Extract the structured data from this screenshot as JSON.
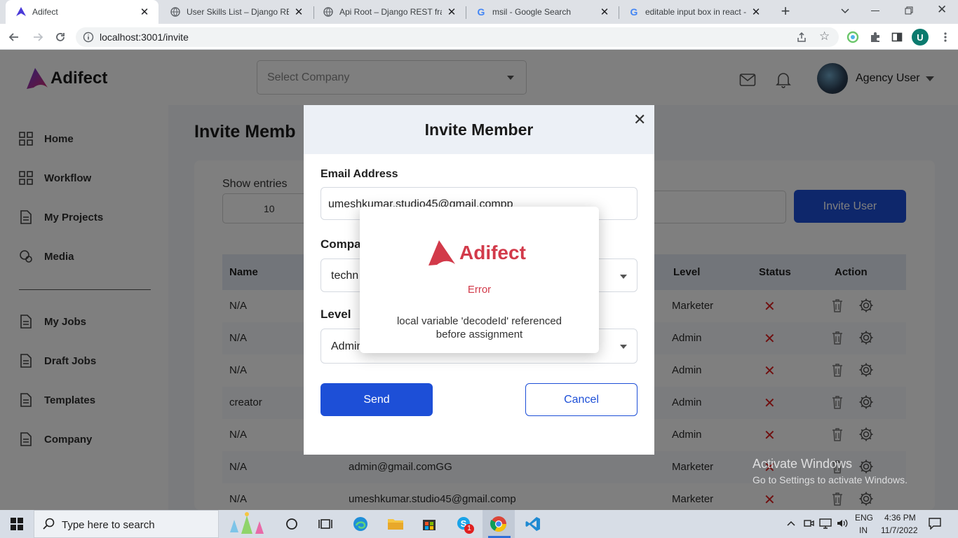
{
  "browser": {
    "tabs": [
      {
        "title": "Adifect",
        "active": true
      },
      {
        "title": "User Skills List – Django REST",
        "active": false
      },
      {
        "title": "Api Root – Django REST fram",
        "active": false
      },
      {
        "title": "msil - Google Search",
        "active": false
      },
      {
        "title": "editable input box in react -",
        "active": false
      }
    ],
    "url": "localhost:3001/invite",
    "profile_initial": "U"
  },
  "app": {
    "logo_text": "Adifect",
    "company_select_placeholder": "Select Company",
    "user_name": "Agency User",
    "sidebar": {
      "items": [
        {
          "label": "Home",
          "icon": "grid-icon"
        },
        {
          "label": "Workflow",
          "icon": "grid-icon"
        },
        {
          "label": "My Projects",
          "icon": "document-icon"
        },
        {
          "label": "Media",
          "icon": "media-icon"
        },
        {
          "label": "My Jobs",
          "icon": "document-icon"
        },
        {
          "label": "Draft Jobs",
          "icon": "document-icon"
        },
        {
          "label": "Templates",
          "icon": "document-icon"
        },
        {
          "label": "Company",
          "icon": "document-icon"
        }
      ]
    },
    "page_title": "Invite Memb",
    "show_entries_label": "Show entries",
    "entries_value": "10",
    "invite_user_button": "Invite User",
    "table": {
      "headers": [
        "Name",
        "Level",
        "Status",
        "Action"
      ],
      "rows": [
        {
          "name": "N/A",
          "email": "",
          "level": "Marketer"
        },
        {
          "name": "N/A",
          "email": "",
          "level": "Admin"
        },
        {
          "name": "N/A",
          "email": "",
          "level": "Admin"
        },
        {
          "name": "creator",
          "email": "",
          "level": "Admin"
        },
        {
          "name": "N/A",
          "email": "",
          "level": "Admin"
        },
        {
          "name": "N/A",
          "email": "admin@gmail.comGG",
          "level": "Marketer"
        },
        {
          "name": "N/A",
          "email": "umeshkumar.studio45@gmail.comp",
          "level": "Marketer"
        }
      ]
    }
  },
  "modal": {
    "title": "Invite Member",
    "email_label": "Email Address",
    "email_value": "umeshkumar.studio45@gmail.compp",
    "company_label": "Compa",
    "company_value": "techn",
    "level_label": "Level",
    "level_value": "Admin",
    "send_button": "Send",
    "cancel_button": "Cancel"
  },
  "alert": {
    "logo_text": "Adifect",
    "title": "Error",
    "message": "local variable 'decodeId' referenced before assignment"
  },
  "watermark": {
    "title": "Activate Windows",
    "subtitle": "Go to Settings to activate Windows."
  },
  "taskbar": {
    "search_placeholder": "Type here to search",
    "language": "ENG",
    "region": "IN",
    "time": "4:36 PM",
    "date": "11/7/2022",
    "notification_count": "1"
  },
  "colors": {
    "brand_red": "#d23a4a",
    "primary_blue": "#1d4fd7",
    "error_red": "#e02020"
  }
}
